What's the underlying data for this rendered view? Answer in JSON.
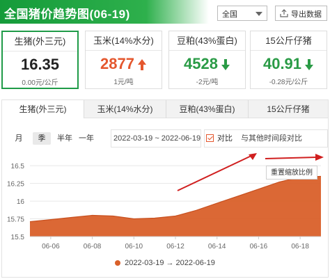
{
  "header": {
    "title": "全国猪价趋势图(06-19)",
    "region": "全国",
    "export_label": "导出数据"
  },
  "cards": [
    {
      "title": "生猪(外三元)",
      "value": "16.35",
      "change": "0.00元/公斤",
      "trend": "flat",
      "color": "#222222"
    },
    {
      "title": "玉米(14%水分)",
      "value": "2877",
      "change": "1元/吨",
      "trend": "up",
      "color": "#e4572e"
    },
    {
      "title": "豆粕(43%蛋白)",
      "value": "4528",
      "change": "-2元/吨",
      "trend": "down",
      "color": "#2a9b46"
    },
    {
      "title": "15公斤仔猪",
      "value": "40.91",
      "change": "-0.28元/公斤",
      "trend": "down",
      "color": "#2a9b46"
    }
  ],
  "tabs": [
    "生猪(外三元)",
    "玉米(14%水分)",
    "豆粕(43%蛋白)",
    "15公斤仔猪"
  ],
  "controls": {
    "ranges": [
      "月",
      "季",
      "半年",
      "一年"
    ],
    "active_range": "季",
    "date_range": "2022-03-19 ~ 2022-06-19",
    "compare_label": "对比",
    "compare_other": "与其他时间段对比",
    "reset_zoom": "重置缩放比例"
  },
  "legend": "2022-03-19 → 2022-06-19",
  "chart_data": {
    "type": "area",
    "x": [
      "06-05",
      "06-06",
      "06-07",
      "06-08",
      "06-09",
      "06-10",
      "06-11",
      "06-12",
      "06-13",
      "06-14",
      "06-15",
      "06-16",
      "06-17",
      "06-18",
      "06-19"
    ],
    "values": [
      15.71,
      15.74,
      15.77,
      15.8,
      15.79,
      15.75,
      15.76,
      15.79,
      15.87,
      15.97,
      16.07,
      16.17,
      16.27,
      16.34,
      16.35
    ],
    "xticks": [
      "06-06",
      "06-08",
      "06-10",
      "06-12",
      "06-14",
      "06-16",
      "06-18"
    ],
    "yticks": [
      15.5,
      15.75,
      16,
      16.25,
      16.5
    ],
    "ylim": [
      15.5,
      16.6
    ],
    "series_color": "#d9602a",
    "grid": "horizontal"
  }
}
